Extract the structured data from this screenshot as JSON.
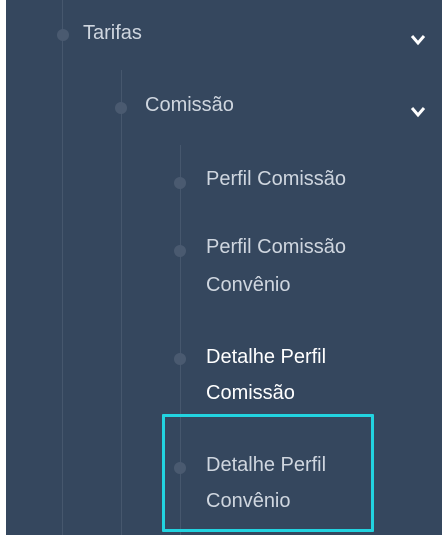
{
  "menu": {
    "tarifas": {
      "label": "Tarifas",
      "icon": "chevron-down-icon"
    },
    "comissao": {
      "label": "Comissão",
      "icon": "chevron-down-icon"
    },
    "items": [
      {
        "line1": "Perfil Comissão",
        "line2": ""
      },
      {
        "line1": "Perfil Comissão",
        "line2": "Convênio"
      },
      {
        "line1": "Detalhe Perfil",
        "line2": "Comissão"
      },
      {
        "line1": "Detalhe Perfil",
        "line2": "Convênio"
      }
    ]
  },
  "colors": {
    "panel_bg": "#35475e",
    "text": "#cfd6df",
    "text_active": "#ffffff",
    "highlight": "#22d3e0"
  }
}
